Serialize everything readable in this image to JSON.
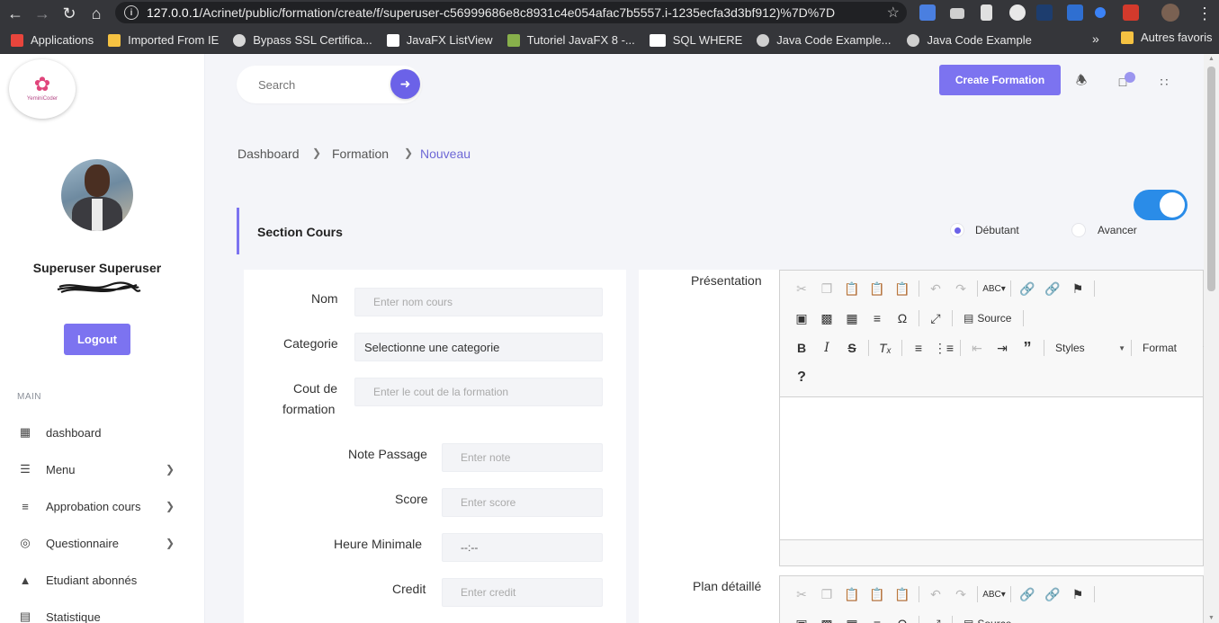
{
  "browser": {
    "url_host": "127.0.0.1",
    "url_path": "/Acrinet/public/formation/create/f/superuser-c56999686e8c8931c4e054afac7b5557.i-1235ecfa3d3bf912)%7D%7D",
    "bookmarks": [
      {
        "label": "Applications",
        "color": "#e8453c"
      },
      {
        "label": "Imported From IE",
        "color": "#f5c242"
      },
      {
        "label": "Bypass SSL Certifica...",
        "color": "#d7d7d7"
      },
      {
        "label": "JavaFX ListView",
        "color": "#111111"
      },
      {
        "label": "Tutoriel JavaFX 8 -...",
        "color": "#88b04b"
      },
      {
        "label": "SQL WHERE",
        "color": "#ffffff"
      },
      {
        "label": "Java Code Example...",
        "color": "#cfcfcf"
      },
      {
        "label": "Java Code Example",
        "color": "#cfcfcf"
      }
    ],
    "more": "»",
    "other_bookmarks": "Autres favoris"
  },
  "sidebar": {
    "logo_text": "YeminiCoder",
    "user_name": "Superuser Superuser",
    "logout_label": "Logout",
    "section_label": "MAIN",
    "items": [
      {
        "label": "dashboard",
        "icon": "grid-icon",
        "has_children": false
      },
      {
        "label": "Menu",
        "icon": "list-icon",
        "has_children": true
      },
      {
        "label": "Approbation cours",
        "icon": "checklist-icon",
        "has_children": true
      },
      {
        "label": "Questionnaire",
        "icon": "target-icon",
        "has_children": true
      },
      {
        "label": "Etudiant abonnés",
        "icon": "graduation-cap-icon",
        "has_children": false
      },
      {
        "label": "Statistique",
        "icon": "chart-icon",
        "has_children": false
      }
    ]
  },
  "topbar": {
    "search_placeholder": "Search",
    "create_label": "Create Formation"
  },
  "breadcrumb": {
    "items": [
      "Dashboard",
      "Formation",
      "Nouveau"
    ]
  },
  "section": {
    "title": "Section Cours",
    "toggle_on": true,
    "levels": [
      {
        "label": "Débutant",
        "selected": true
      },
      {
        "label": "Avancer",
        "selected": false
      }
    ]
  },
  "form": {
    "nom": {
      "label": "Nom",
      "placeholder": "Enter nom cours"
    },
    "categorie": {
      "label": "Categorie",
      "value": "Selectionne une categorie"
    },
    "cout": {
      "label_line1": "Cout de",
      "label_line2": "formation",
      "placeholder": "Enter le cout de la formation"
    },
    "note": {
      "label": "Note Passage",
      "placeholder": "Enter note"
    },
    "score": {
      "label": "Score",
      "placeholder": "Enter score"
    },
    "heure": {
      "label": "Heure Minimale",
      "value": "--:--"
    },
    "credit": {
      "label": "Credit",
      "placeholder": "Enter credit"
    }
  },
  "editors": {
    "presentation_label": "Présentation",
    "plan_label": "Plan détaillé",
    "source_label": "Source",
    "styles_label": "Styles",
    "format_label": "Format"
  },
  "colors": {
    "accent": "#7c73f0",
    "toggle": "#2a8ce8"
  }
}
